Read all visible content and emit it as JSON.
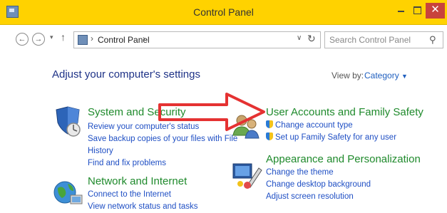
{
  "window": {
    "title": "Control Panel"
  },
  "address_bar": {
    "location": "Control Panel",
    "search_placeholder": "Search Control Panel"
  },
  "main": {
    "heading": "Adjust your computer's settings",
    "view_by_label": "View by:",
    "view_by_value": "Category",
    "categories": [
      {
        "title": "System and Security",
        "links": [
          "Review your computer's status",
          "Save backup copies of your files with File",
          "History",
          "Find and fix problems"
        ]
      },
      {
        "title": "Network and Internet",
        "links": [
          "Connect to the Internet",
          "View network status and tasks"
        ]
      },
      {
        "title": "User Accounts and Family Safety",
        "links": [
          "Change account type",
          "Set up Family Safety for any user"
        ]
      },
      {
        "title": "Appearance and Personalization",
        "links": [
          "Change the theme",
          "Change desktop background",
          "Adjust screen resolution"
        ]
      }
    ]
  },
  "colors": {
    "title_bar": "#ffd200",
    "close_button": "#c8433c",
    "category_title": "#1f8a2c",
    "link": "#1f4fc4",
    "heading": "#1e3287",
    "arrow": "#e53232"
  }
}
